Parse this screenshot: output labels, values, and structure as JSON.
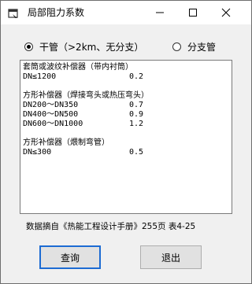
{
  "window": {
    "title": "局部阻力系数",
    "icon": "app-window-icon",
    "controls": {
      "minimize": "—",
      "maximize": "☐",
      "close": "✕"
    }
  },
  "options": {
    "main_pipe": {
      "label": "干管（>2km、无分支）",
      "checked": true
    },
    "branch_pipe": {
      "label": "分支管",
      "checked": false
    }
  },
  "content": {
    "sections": [
      {
        "title": "套筒或波纹补偿器（带内衬筒）",
        "rows": [
          {
            "size": "DN≤1200",
            "value": "0.2"
          }
        ]
      },
      {
        "title": "方形补偿器（焊接弯头或热压弯头）",
        "rows": [
          {
            "size": "DN200～DN350",
            "value": "0.7"
          },
          {
            "size": "DN400～DN500",
            "value": "0.9"
          },
          {
            "size": "DN600～DN1000",
            "value": "1.2"
          }
        ]
      },
      {
        "title": "方形补偿器（煨制弯管）",
        "rows": [
          {
            "size": "DN≤300",
            "value": "0.5"
          }
        ]
      }
    ]
  },
  "footnote": "数据摘自《热能工程设计手册》255页 表4-25",
  "buttons": {
    "query": "查询",
    "exit": "退出"
  }
}
